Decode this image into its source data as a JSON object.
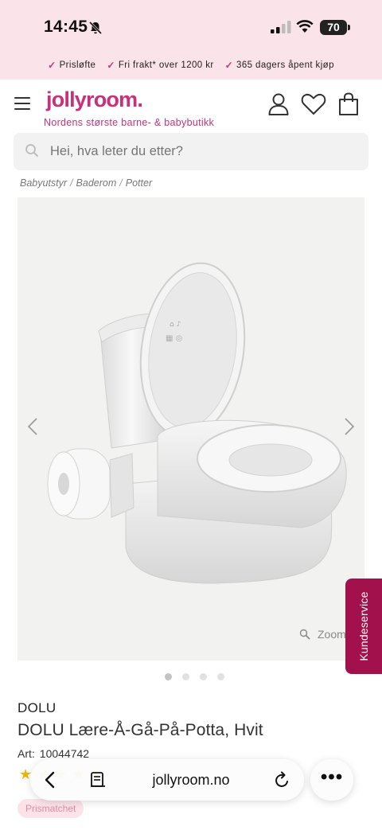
{
  "status_bar": {
    "time": "14:45",
    "battery": "70",
    "icons": [
      "bell-slash-icon",
      "signal-icon",
      "wifi-icon",
      "battery-icon"
    ]
  },
  "usp": [
    {
      "label": "Prisløfte"
    },
    {
      "label": "Fri frakt* over 1200 kr"
    },
    {
      "label": "365 dagers åpent kjøp"
    }
  ],
  "header": {
    "logo": "jollyroom.",
    "tagline": "Nordens største barne- & babybutikk",
    "icons": [
      "menu-icon",
      "account-icon",
      "wishlist-heart-icon",
      "cart-bag-icon"
    ]
  },
  "search": {
    "placeholder": "Hei, hva leter du etter?"
  },
  "breadcrumb": [
    {
      "label": "Babyutstyr"
    },
    {
      "label": "Baderom"
    },
    {
      "label": "Potter"
    }
  ],
  "breadcrumb_separator": "/",
  "gallery": {
    "zoom_label": "Zoom",
    "image_count": 4,
    "active_index": 0
  },
  "kundeservice": {
    "label": "Kundeservice"
  },
  "product": {
    "brand": "DOLU",
    "title": "DOLU Lære-Å-Gå-På-Potta, Hvit",
    "art_label": "Art:",
    "art_number": "10044742",
    "badge": "Prismatchet"
  },
  "browser": {
    "url": "jollyroom.no",
    "more": "•••"
  },
  "colors": {
    "brand_pink": "#c8317a",
    "top_bar_bg": "#fbe3ea",
    "kundeservice_bg": "#a3114d",
    "star": "#f0b400"
  }
}
